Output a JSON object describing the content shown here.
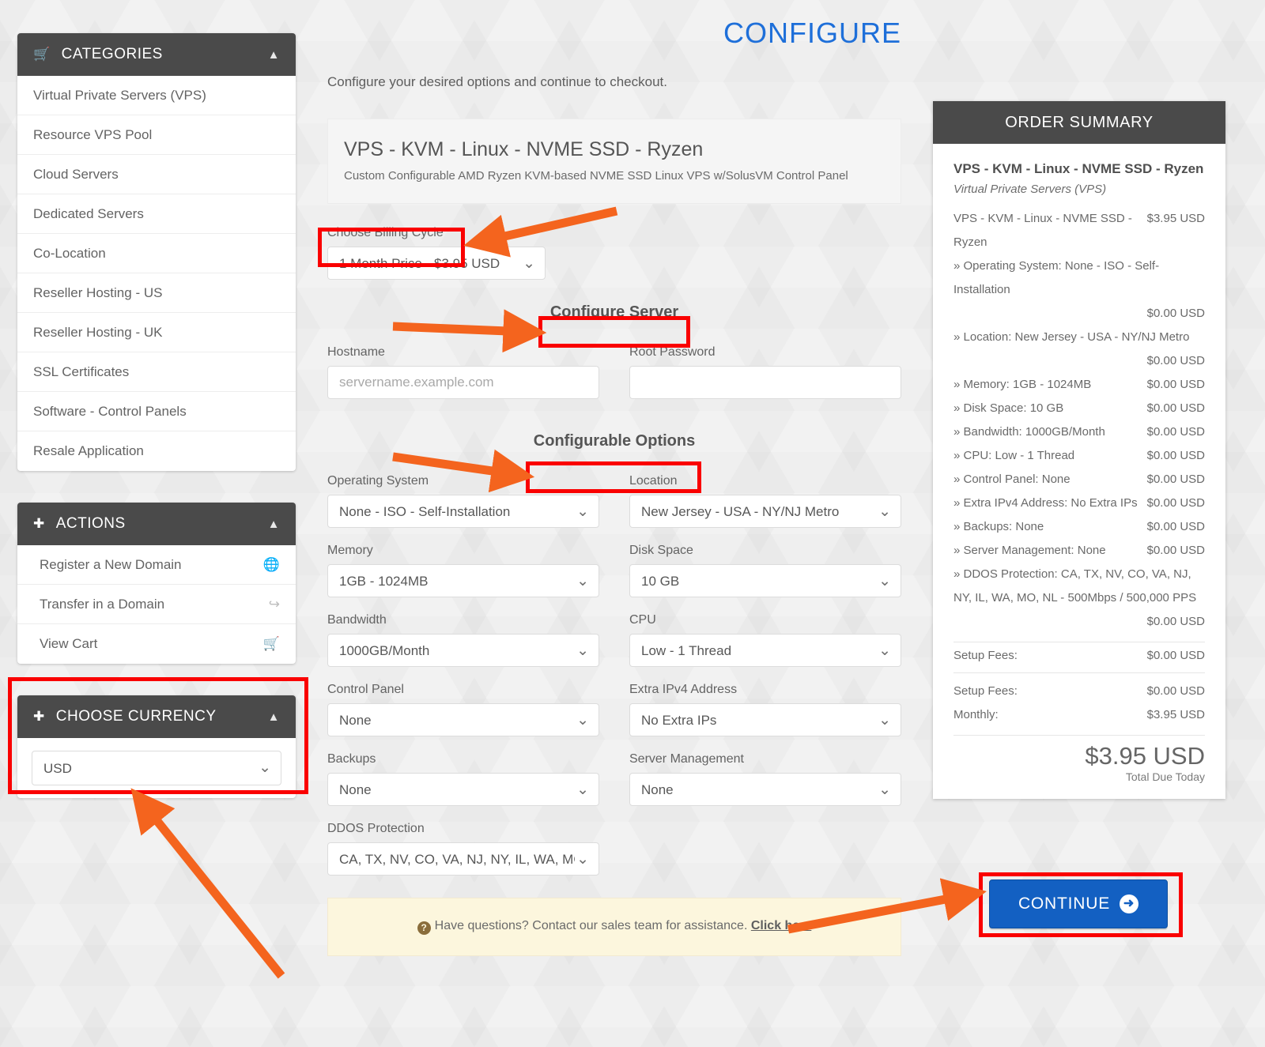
{
  "sidebar": {
    "categories": {
      "title": "CATEGORIES",
      "icon": "cart-icon",
      "collapse_icon": "chevron-up-icon",
      "items": [
        "Virtual Private Servers (VPS)",
        "Resource VPS Pool",
        "Cloud Servers",
        "Dedicated Servers",
        "Co-Location",
        "Reseller Hosting - US",
        "Reseller Hosting - UK",
        "SSL Certificates",
        "Software - Control Panels",
        "Resale Application"
      ]
    },
    "actions": {
      "title": "ACTIONS",
      "icon": "plus-icon",
      "collapse_icon": "chevron-up-icon",
      "items": [
        {
          "label": "Register a New Domain",
          "icon": "globe-icon"
        },
        {
          "label": "Transfer in a Domain",
          "icon": "share-arrow-icon"
        },
        {
          "label": "View Cart",
          "icon": "cart-icon"
        }
      ]
    },
    "currency": {
      "title": "CHOOSE CURRENCY",
      "icon": "plus-icon",
      "collapse_icon": "chevron-up-icon",
      "selected": "USD",
      "options": [
        "USD"
      ]
    }
  },
  "main": {
    "page_title": "CONFIGURE",
    "lead": "Configure your desired options and continue to checkout.",
    "product": {
      "name": "VPS - KVM - Linux - NVME SSD - Ryzen",
      "description": "Custom Configurable AMD Ryzen KVM-based NVME SSD Linux VPS w/SolusVM Control Panel"
    },
    "billing": {
      "label": "Choose Billing Cycle",
      "selected": "1 Month Price - $3.95 USD",
      "options": [
        "1 Month Price - $3.95 USD"
      ]
    },
    "configure_server_heading": "Configure Server",
    "hostname": {
      "label": "Hostname",
      "value": "",
      "placeholder": "servername.example.com"
    },
    "root_password": {
      "label": "Root Password",
      "value": "",
      "placeholder": ""
    },
    "configurable_options_heading": "Configurable Options",
    "options": [
      {
        "label": "Operating System",
        "selected": "None - ISO - Self-Installation"
      },
      {
        "label": "Location",
        "selected": "New Jersey - USA - NY/NJ Metro"
      },
      {
        "label": "Memory",
        "selected": "1GB - 1024MB"
      },
      {
        "label": "Disk Space",
        "selected": "10 GB"
      },
      {
        "label": "Bandwidth",
        "selected": "1000GB/Month"
      },
      {
        "label": "CPU",
        "selected": "Low - 1 Thread"
      },
      {
        "label": "Control Panel",
        "selected": "None"
      },
      {
        "label": "Extra IPv4 Address",
        "selected": "No Extra IPs"
      },
      {
        "label": "Backups",
        "selected": "None"
      },
      {
        "label": "Server Management",
        "selected": "None"
      },
      {
        "label": "DDOS Protection",
        "selected": "CA, TX, NV, CO, VA, NJ, NY, IL, WA, MO"
      }
    ],
    "notice": {
      "icon": "question-circle-icon",
      "text": "Have questions? Contact our sales team for assistance.",
      "link": "Click here"
    }
  },
  "summary": {
    "title": "ORDER SUMMARY",
    "product_name": "VPS - KVM - Linux - NVME SSD - Ryzen",
    "product_category": "Virtual Private Servers (VPS)",
    "lines": [
      {
        "label": "VPS - KVM - Linux - NVME SSD - Ryzen",
        "amount": "$3.95 USD",
        "wrap": false
      },
      {
        "label": "» Operating System: None - ISO - Self-Installation",
        "amount": "$0.00 USD",
        "wrap": true
      },
      {
        "label": "» Location: New Jersey - USA - NY/NJ Metro",
        "amount": "$0.00 USD",
        "wrap": true
      },
      {
        "label": "» Memory: 1GB - 1024MB",
        "amount": "$0.00 USD",
        "wrap": false
      },
      {
        "label": "» Disk Space: 10 GB",
        "amount": "$0.00 USD",
        "wrap": false
      },
      {
        "label": "» Bandwidth: 1000GB/Month",
        "amount": "$0.00 USD",
        "wrap": false
      },
      {
        "label": "» CPU: Low - 1 Thread",
        "amount": "$0.00 USD",
        "wrap": false
      },
      {
        "label": "» Control Panel: None",
        "amount": "$0.00 USD",
        "wrap": false
      },
      {
        "label": "» Extra IPv4 Address: No Extra IPs",
        "amount": "$0.00 USD",
        "wrap": false
      },
      {
        "label": "» Backups: None",
        "amount": "$0.00 USD",
        "wrap": false
      },
      {
        "label": "» Server Management: None",
        "amount": "$0.00 USD",
        "wrap": false
      },
      {
        "label": "» DDOS Protection: CA, TX, NV, CO, VA, NJ, NY, IL, WA, MO, NL - 500Mbps / 500,000 PPS",
        "amount": "$0.00 USD",
        "wrap": true
      }
    ],
    "clipped_fees": [
      {
        "label": "Setup Fees:",
        "amount": "$0.00 USD"
      },
      {
        "label": "Monthly:",
        "amount": "$3.95 USD"
      }
    ],
    "fees": [
      {
        "label": "Setup Fees:",
        "amount": "$0.00 USD"
      },
      {
        "label": "Monthly:",
        "amount": "$3.95 USD"
      }
    ],
    "total": "$3.95 USD",
    "total_label": "Total Due Today"
  },
  "continue_button": {
    "label": "CONTINUE",
    "icon": "arrow-right-circle-icon"
  },
  "annotations": {
    "highlight_color": "#fa0000",
    "arrow_color": "#f4641e",
    "boxes": [
      "choose-billing-cycle",
      "configure-server",
      "configurable-options",
      "choose-currency",
      "continue-button"
    ]
  },
  "colors": {
    "accent_blue": "#1e6fd9",
    "button_blue": "#1360c2",
    "panel_header": "#4a4a4a",
    "page_background": "#f2f2f2",
    "notice_background": "#fcf6dd"
  }
}
